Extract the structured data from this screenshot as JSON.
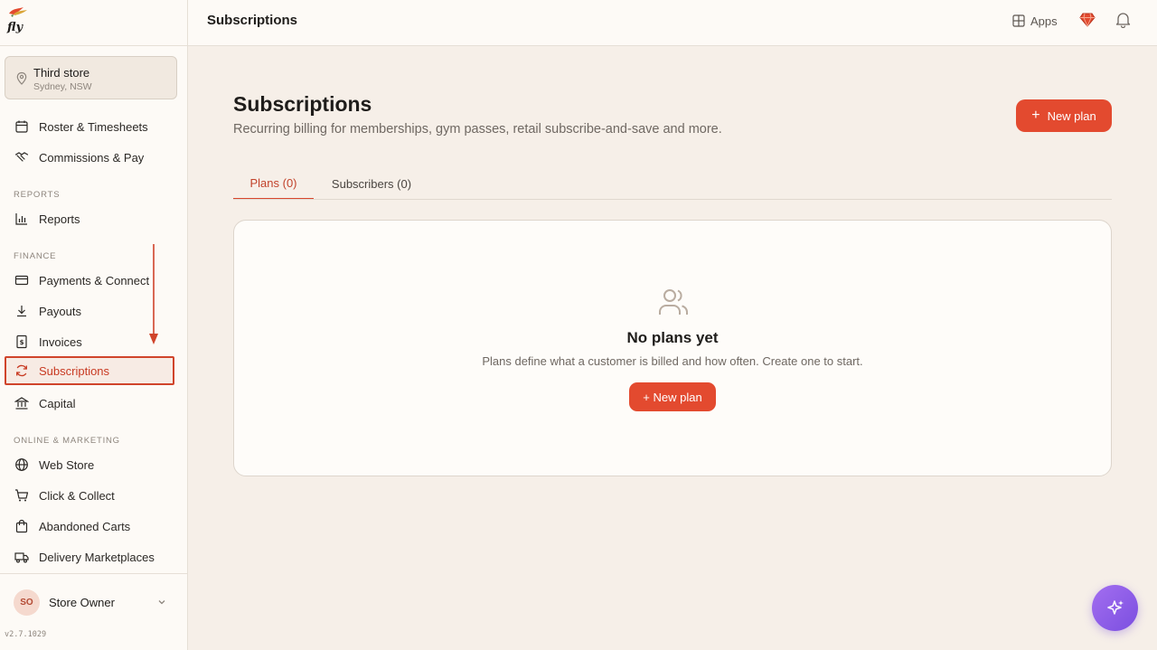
{
  "brand": {
    "logo_text": "fly"
  },
  "store": {
    "name": "Third store",
    "location": "Sydney, NSW"
  },
  "sidebar": {
    "top_items": [
      {
        "label": "Roster & Timesheets"
      },
      {
        "label": "Commissions & Pay"
      }
    ],
    "sections": {
      "reports": "REPORTS",
      "finance": "FINANCE",
      "online": "ONLINE & MARKETING"
    },
    "reports_items": [
      {
        "label": "Reports"
      }
    ],
    "finance_items": [
      {
        "label": "Payments & Connect"
      },
      {
        "label": "Payouts"
      },
      {
        "label": "Invoices"
      },
      {
        "label": "Subscriptions"
      },
      {
        "label": "Capital"
      }
    ],
    "online_items": [
      {
        "label": "Web Store"
      },
      {
        "label": "Click & Collect"
      },
      {
        "label": "Abandoned Carts"
      },
      {
        "label": "Delivery Marketplaces"
      }
    ],
    "active_item": "Subscriptions"
  },
  "user": {
    "initials": "SO",
    "name": "Store Owner"
  },
  "version": "v2.7.1029",
  "topbar": {
    "title": "Subscriptions",
    "apps_label": "Apps"
  },
  "main": {
    "title": "Subscriptions",
    "subtitle": "Recurring billing for memberships, gym passes, retail subscribe-and-save and more.",
    "new_plan_label": "New plan",
    "tabs": [
      {
        "label": "Plans (0)",
        "active": true
      },
      {
        "label": "Subscribers (0)",
        "active": false
      }
    ],
    "empty": {
      "title": "No plans yet",
      "description": "Plans define what a customer is billed and how often. Create one to start.",
      "button_label": "+ New plan"
    }
  },
  "colors": {
    "accent": "#e34a2f",
    "active_text": "#c83a22",
    "fab": "#8a5ce6",
    "background": "#f6efe8"
  }
}
